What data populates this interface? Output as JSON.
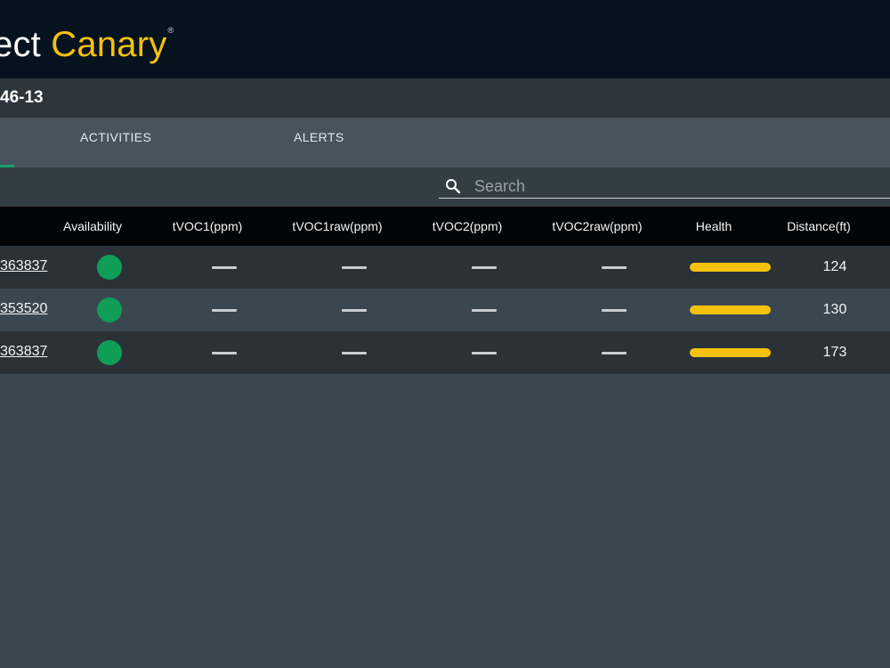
{
  "app": {
    "brand_prefix": "ect",
    "brand_name": "Canary",
    "brand_mark": "®",
    "colors": {
      "header_bg": "#06131f",
      "brand_accent": "#f4c20d",
      "tab_indicator": "#16a163",
      "available": "#0f9d58",
      "health": "#f4c20d"
    }
  },
  "device": {
    "id": "46-13"
  },
  "tabs": [
    {
      "label": "ACTIVITIES"
    },
    {
      "label": "ALERTS"
    }
  ],
  "search": {
    "icon": "search-icon",
    "placeholder": "Search",
    "value": ""
  },
  "table": {
    "columns": [
      "Availability",
      "tVOC1(ppm)",
      "tVOC1raw(ppm)",
      "tVOC2(ppm)",
      "tVOC2raw(ppm)",
      "Health",
      "Distance(ft)"
    ],
    "rows": [
      {
        "sensor_id": "363837",
        "availability": "available",
        "tvoc1": "—",
        "tvoc1raw": "—",
        "tvoc2": "—",
        "tvoc2raw": "—",
        "health": "good",
        "distance": "124"
      },
      {
        "sensor_id": "353520",
        "availability": "available",
        "tvoc1": "—",
        "tvoc1raw": "—",
        "tvoc2": "—",
        "tvoc2raw": "—",
        "health": "good",
        "distance": "130"
      },
      {
        "sensor_id": "363837",
        "availability": "available",
        "tvoc1": "—",
        "tvoc1raw": "—",
        "tvoc2": "—",
        "tvoc2raw": "—",
        "health": "good",
        "distance": "173"
      }
    ]
  }
}
